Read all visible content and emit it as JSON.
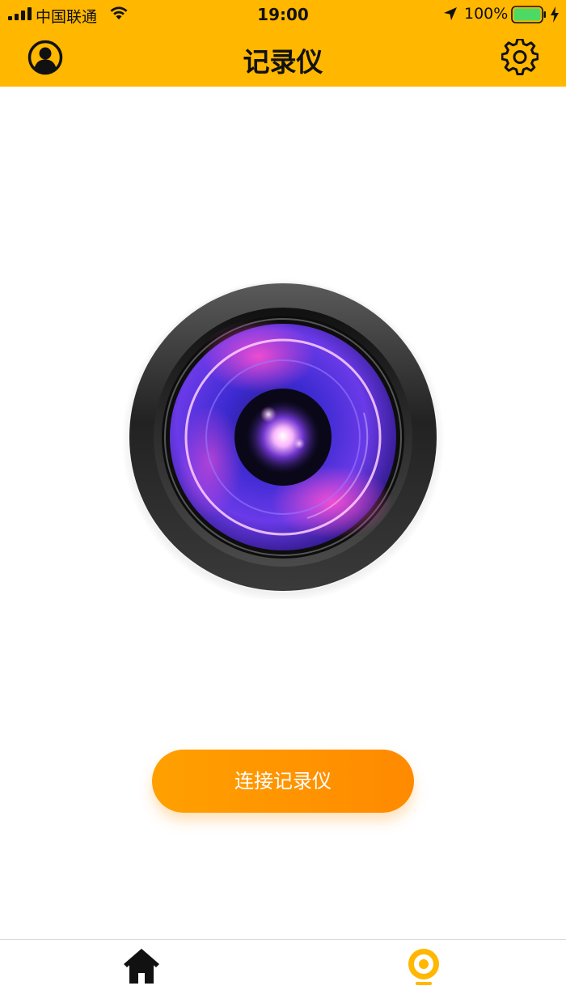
{
  "status_bar": {
    "carrier": "中国联通",
    "time": "19:00",
    "battery_percent": "100%",
    "battery_level": 1.0,
    "icons": [
      "signal-icon",
      "wifi-icon",
      "location-icon",
      "battery-icon",
      "charging-icon"
    ]
  },
  "nav": {
    "title": "记录仪",
    "left_icon": "profile-icon",
    "right_icon": "gear-icon"
  },
  "main": {
    "hero_image": "camera-lens",
    "connect_label": "连接记录仪"
  },
  "tab_bar": {
    "tabs": [
      {
        "icon": "home-icon",
        "active": false
      },
      {
        "icon": "recorder-icon",
        "active": true
      }
    ]
  },
  "colors": {
    "accent": "#FFB700",
    "button_start": "#FFA000",
    "button_end": "#FF8A00",
    "tab_active": "#FFB700",
    "text_dark": "#111111"
  }
}
